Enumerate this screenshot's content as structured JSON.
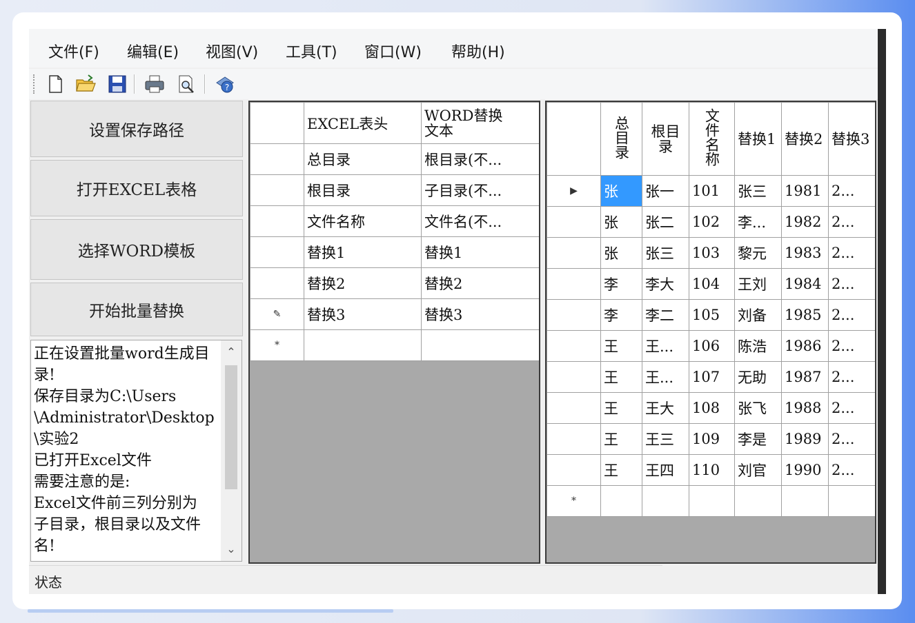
{
  "menu": [
    "文件(F)",
    "编辑(E)",
    "视图(V)",
    "工具(T)",
    "窗口(W)",
    "帮助(H)"
  ],
  "toolbar": {
    "icons": [
      "new-icon",
      "open-folder-icon",
      "save-icon",
      "print-icon",
      "print-preview-icon",
      "help-icon"
    ]
  },
  "buttons": {
    "set_path": "设置保存路径",
    "open_excel": "打开EXCEL表格",
    "select_word": "选择WORD模板",
    "start_replace": "开始批量替换"
  },
  "log": [
    "正在设置批量word生成目",
    "录!",
    "保存目录为C:\\Users",
    "\\Administrator\\Desktop",
    "\\实验2",
    "已打开Excel文件",
    "需要注意的是:",
    "Excel文件前三列分别为",
    "子目录，根目录以及文件",
    "名!"
  ],
  "status": "状态",
  "mapping_grid": {
    "headers": [
      "EXCEL表头",
      "WORD替换\n文本"
    ],
    "rows": [
      [
        "总目录",
        "根目录(不..."
      ],
      [
        "根目录",
        "子目录(不..."
      ],
      [
        "文件名称",
        "文件名(不..."
      ],
      [
        "替换1",
        "替换1"
      ],
      [
        "替换2",
        "替换2"
      ],
      [
        "替换3",
        "替换3"
      ]
    ],
    "editing_row_marker": "✎",
    "new_row_marker": "*"
  },
  "data_grid": {
    "headers": [
      "总目录",
      "根目录",
      "文件名称",
      "替换1",
      "替换2",
      "替换3"
    ],
    "rows": [
      [
        "张",
        "张一",
        "101",
        "张三",
        "1981",
        "2..."
      ],
      [
        "张",
        "张二",
        "102",
        "李...",
        "1982",
        "2..."
      ],
      [
        "张",
        "张三",
        "103",
        "黎元",
        "1983",
        "2..."
      ],
      [
        "李",
        "李大",
        "104",
        "王刘",
        "1984",
        "2..."
      ],
      [
        "李",
        "李二",
        "105",
        "刘备",
        "1985",
        "2..."
      ],
      [
        "王",
        "王...",
        "106",
        "陈浩",
        "1986",
        "2..."
      ],
      [
        "王",
        "王...",
        "107",
        "无助",
        "1987",
        "2..."
      ],
      [
        "王",
        "王大",
        "108",
        "张飞",
        "1988",
        "2..."
      ],
      [
        "王",
        "王三",
        "109",
        "李是",
        "1989",
        "2..."
      ],
      [
        "王",
        "王四",
        "110",
        "刘官",
        "1990",
        "2..."
      ]
    ],
    "current_row_marker": "▶",
    "new_row_marker": "*"
  }
}
